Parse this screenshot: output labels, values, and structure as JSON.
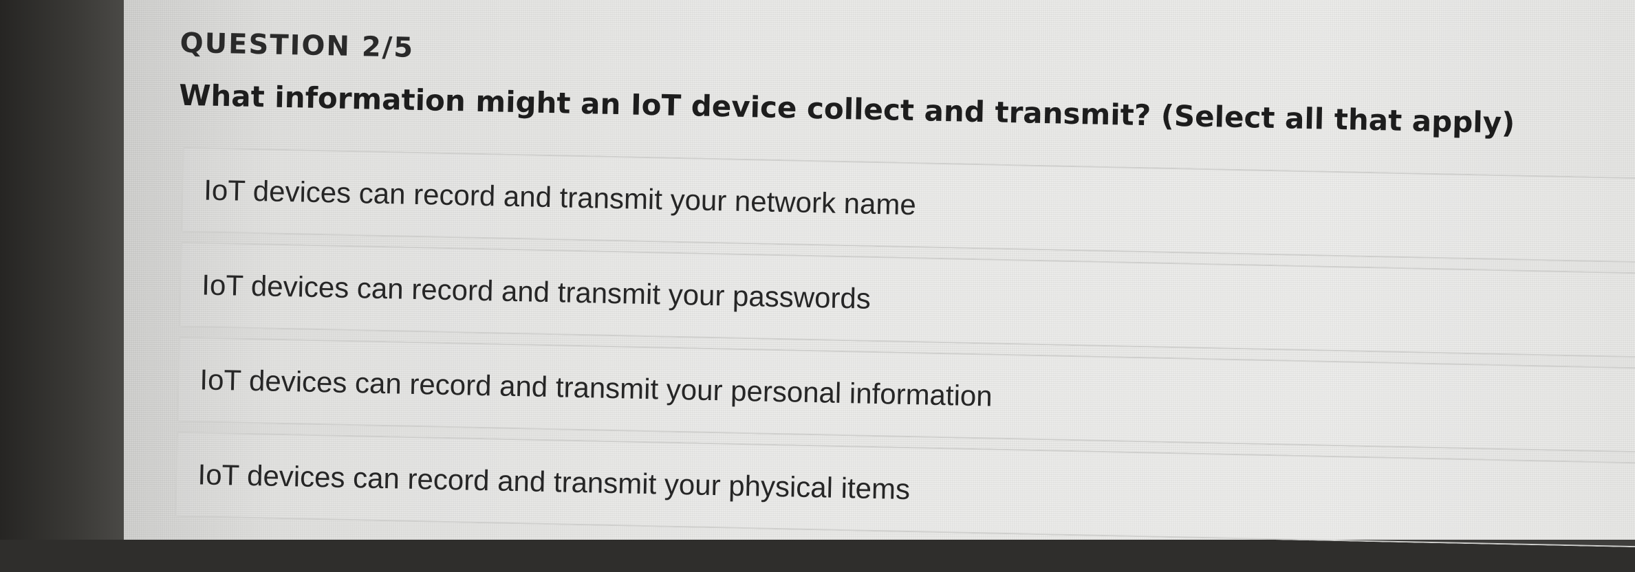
{
  "quiz": {
    "question_number": "QUESTION 2/5",
    "question_text": "What information might an IoT device collect and transmit? (Select all that apply)",
    "answers": [
      {
        "label": "IoT devices can record and transmit your network name"
      },
      {
        "label": "IoT devices can record and transmit your passwords"
      },
      {
        "label": "IoT devices can record and transmit your personal information"
      },
      {
        "label": "IoT devices can record and transmit your physical items"
      }
    ]
  },
  "colors": {
    "background": "#ececea",
    "text": "#1d1d1d",
    "option_border": "#cfcfcd",
    "bezel": "#2f2e2c"
  }
}
